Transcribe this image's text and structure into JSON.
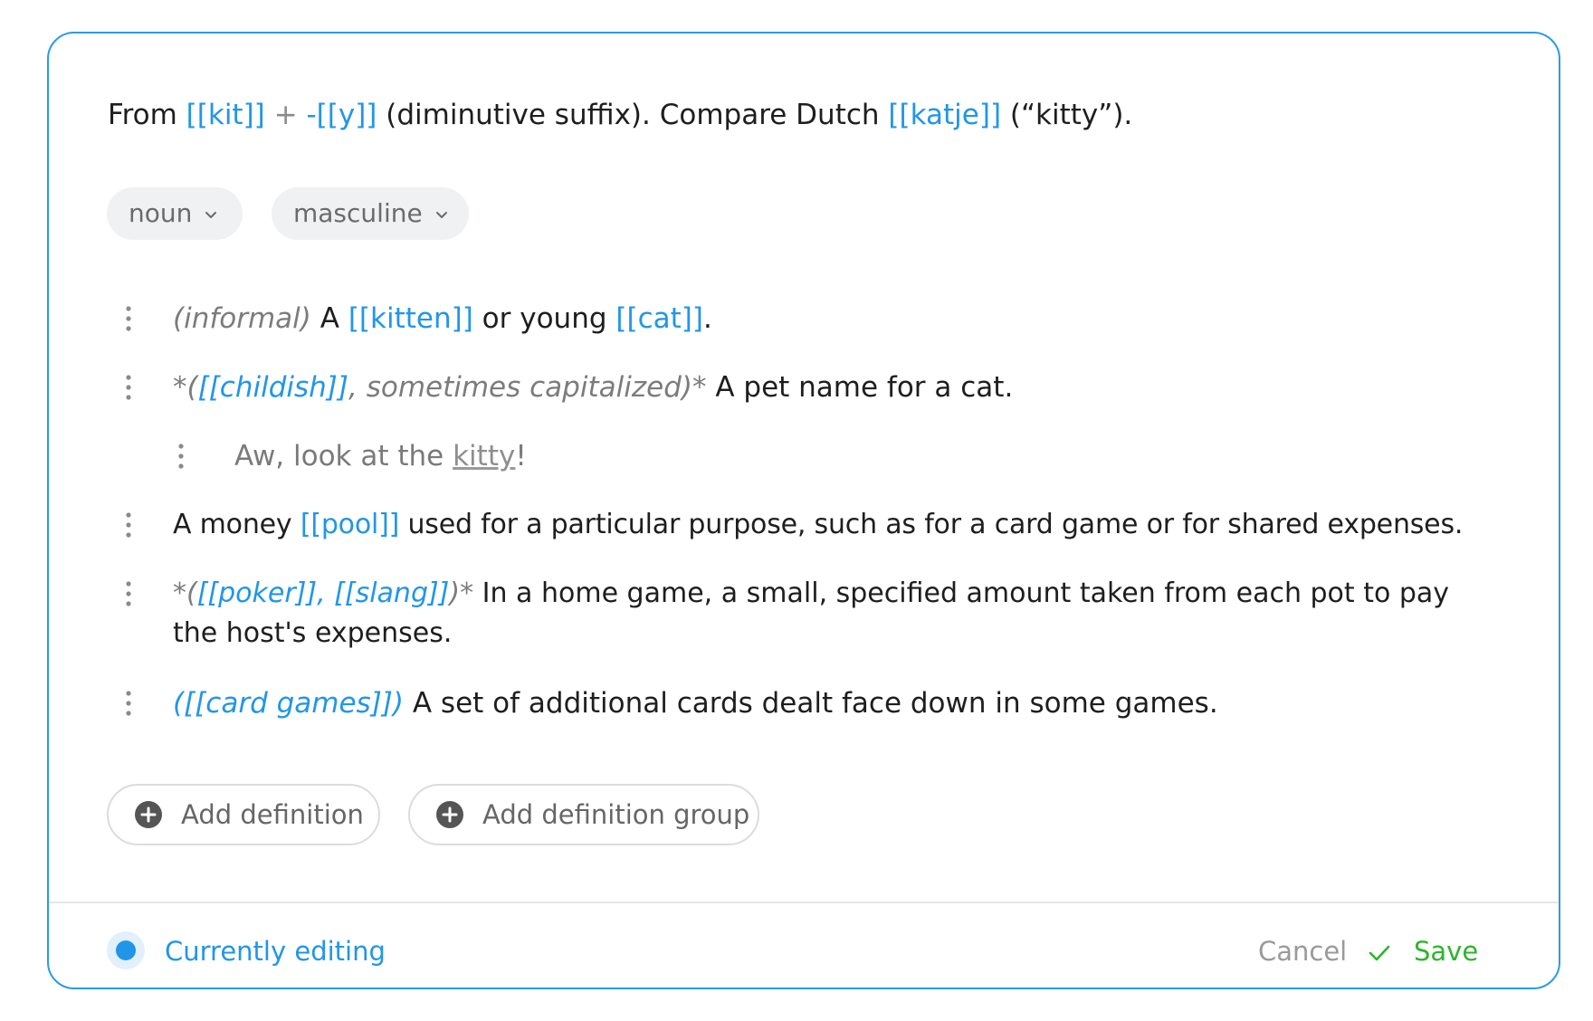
{
  "etymology": {
    "from": "From",
    "kit": "[[kit]]",
    "plus": "+",
    "suffix": "-[[y]]",
    "suffix_desc": "(diminutive suffix). Compare Dutch",
    "katje": "[[katje]]",
    "gloss": "(“kitty”)."
  },
  "tags": {
    "part_of_speech": "noun",
    "gender": "masculine"
  },
  "definitions": [
    {
      "label": "(informal)",
      "t1": "A",
      "link1": "[[kitten]]",
      "t2": "or young",
      "link2": "[[cat]]",
      "t3": "."
    },
    {
      "prefix": "*(",
      "label_link": "[[childish]]",
      "label_rest": ", sometimes capitalized)*",
      "text": "A pet name for a cat.",
      "example": {
        "before": "Aw, look at the",
        "keyword": "kitty",
        "after": "!"
      }
    },
    {
      "t1": "A money",
      "link1": "[[pool]]",
      "t2": "used for a particular purpose, such as for a card game or for shared expenses."
    },
    {
      "prefix": "*(",
      "label_link": "[[poker]], [[slang]]",
      "suffix": ")*",
      "text": "In a home game, a small, specified amount taken from each pot to pay the host's expenses."
    },
    {
      "prefix": "(",
      "label_link": "[[card games]]",
      "suffix": ")",
      "text": "A set of additional cards dealt face down in some games."
    }
  ],
  "actions": {
    "add_definition": "Add definition",
    "add_definition_group": "Add definition group"
  },
  "footer": {
    "status": "Currently editing",
    "cancel": "Cancel",
    "save": "Save"
  },
  "colors": {
    "accent": "#2196e8",
    "border": "#2b9be8",
    "save": "#2db52d",
    "tag_bg": "#f0f1f2"
  },
  "icons": {
    "drag_handle": "vertical-ellipsis-icon",
    "dropdown": "chevron-down-icon",
    "add": "plus-circle-icon",
    "save": "check-icon",
    "status": "status-dot-icon"
  }
}
